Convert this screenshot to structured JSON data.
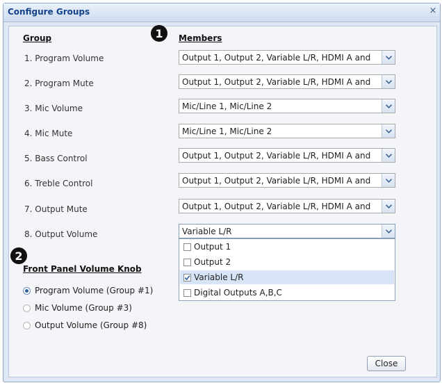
{
  "window": {
    "title": "Configure Groups",
    "close_glyph": "×"
  },
  "columns": {
    "group": "Group",
    "members": "Members"
  },
  "callouts": {
    "one": "1",
    "two": "2"
  },
  "groups": [
    {
      "label": "1. Program Volume",
      "members": "Output 1, Output 2, Variable L/R, HDMI A and"
    },
    {
      "label": "2. Program Mute",
      "members": "Output 1, Output 2, Variable L/R, HDMI A and"
    },
    {
      "label": "3. Mic Volume",
      "members": "Mic/Line 1, Mic/Line 2"
    },
    {
      "label": "4. Mic Mute",
      "members": "Mic/Line 1, Mic/Line 2"
    },
    {
      "label": "5. Bass Control",
      "members": "Output 1, Output 2, Variable L/R, HDMI A and"
    },
    {
      "label": "6. Treble Control",
      "members": "Output 1, Output 2, Variable L/R, HDMI A and"
    },
    {
      "label": "7. Output Mute",
      "members": "Output 1, Output 2, Variable L/R, HDMI A and"
    },
    {
      "label": "8. Output Volume",
      "members": "Variable L/R"
    }
  ],
  "dropdown_options": [
    {
      "label": "Output 1",
      "checked": false
    },
    {
      "label": "Output 2",
      "checked": false
    },
    {
      "label": "Variable L/R",
      "checked": true
    },
    {
      "label": "Digital Outputs A,B,C",
      "checked": false
    }
  ],
  "front_panel": {
    "title": "Front Panel Volume Knob",
    "options": [
      {
        "label": "Program Volume (Group #1)",
        "selected": true
      },
      {
        "label": "Mic Volume (Group #3)",
        "selected": false
      },
      {
        "label": "Output Volume (Group #8)",
        "selected": false
      }
    ]
  },
  "buttons": {
    "close": "Close"
  },
  "icons": {
    "dropdown_arrow": "chevron-down-icon",
    "check": "checkmark-icon"
  },
  "colors": {
    "accent": "#15428b",
    "selection": "#d7e4f5",
    "radio_selected": "#2d5fa0"
  }
}
